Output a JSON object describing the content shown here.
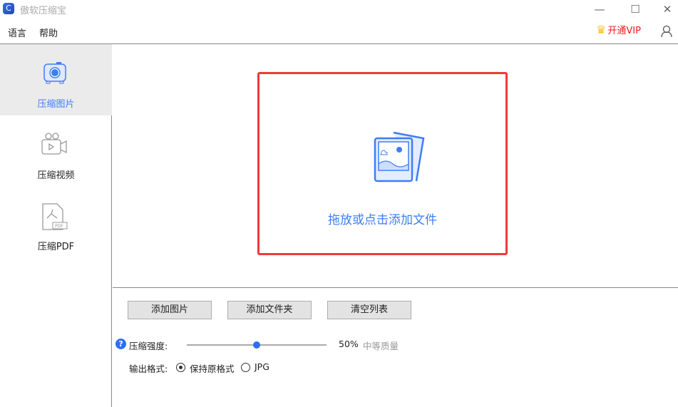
{
  "window": {
    "title": "傲软压缩宝",
    "logo_glyph": "C"
  },
  "menu": {
    "language": "语言",
    "help": "帮助",
    "vip": "开通VIP"
  },
  "sidebar": {
    "items": [
      {
        "label": "压缩图片",
        "active": true
      },
      {
        "label": "压缩视频"
      },
      {
        "label": "压缩PDF"
      }
    ]
  },
  "dropzone": {
    "text": "拖放或点击添加文件"
  },
  "buttons": {
    "add_image": "添加图片",
    "add_folder": "添加文件夹",
    "clear_list": "清空列表"
  },
  "compression": {
    "label": "压缩强度:",
    "percent": 50,
    "value_text": "50%",
    "quality": "中等质量"
  },
  "output": {
    "label": "输出格式:",
    "options": [
      {
        "label": "保持原格式",
        "selected": true
      },
      {
        "label": "JPG",
        "selected": false
      }
    ]
  },
  "colors": {
    "accent": "#2a6ff5",
    "drop_border": "#f0393b",
    "vip": "#f01818"
  }
}
